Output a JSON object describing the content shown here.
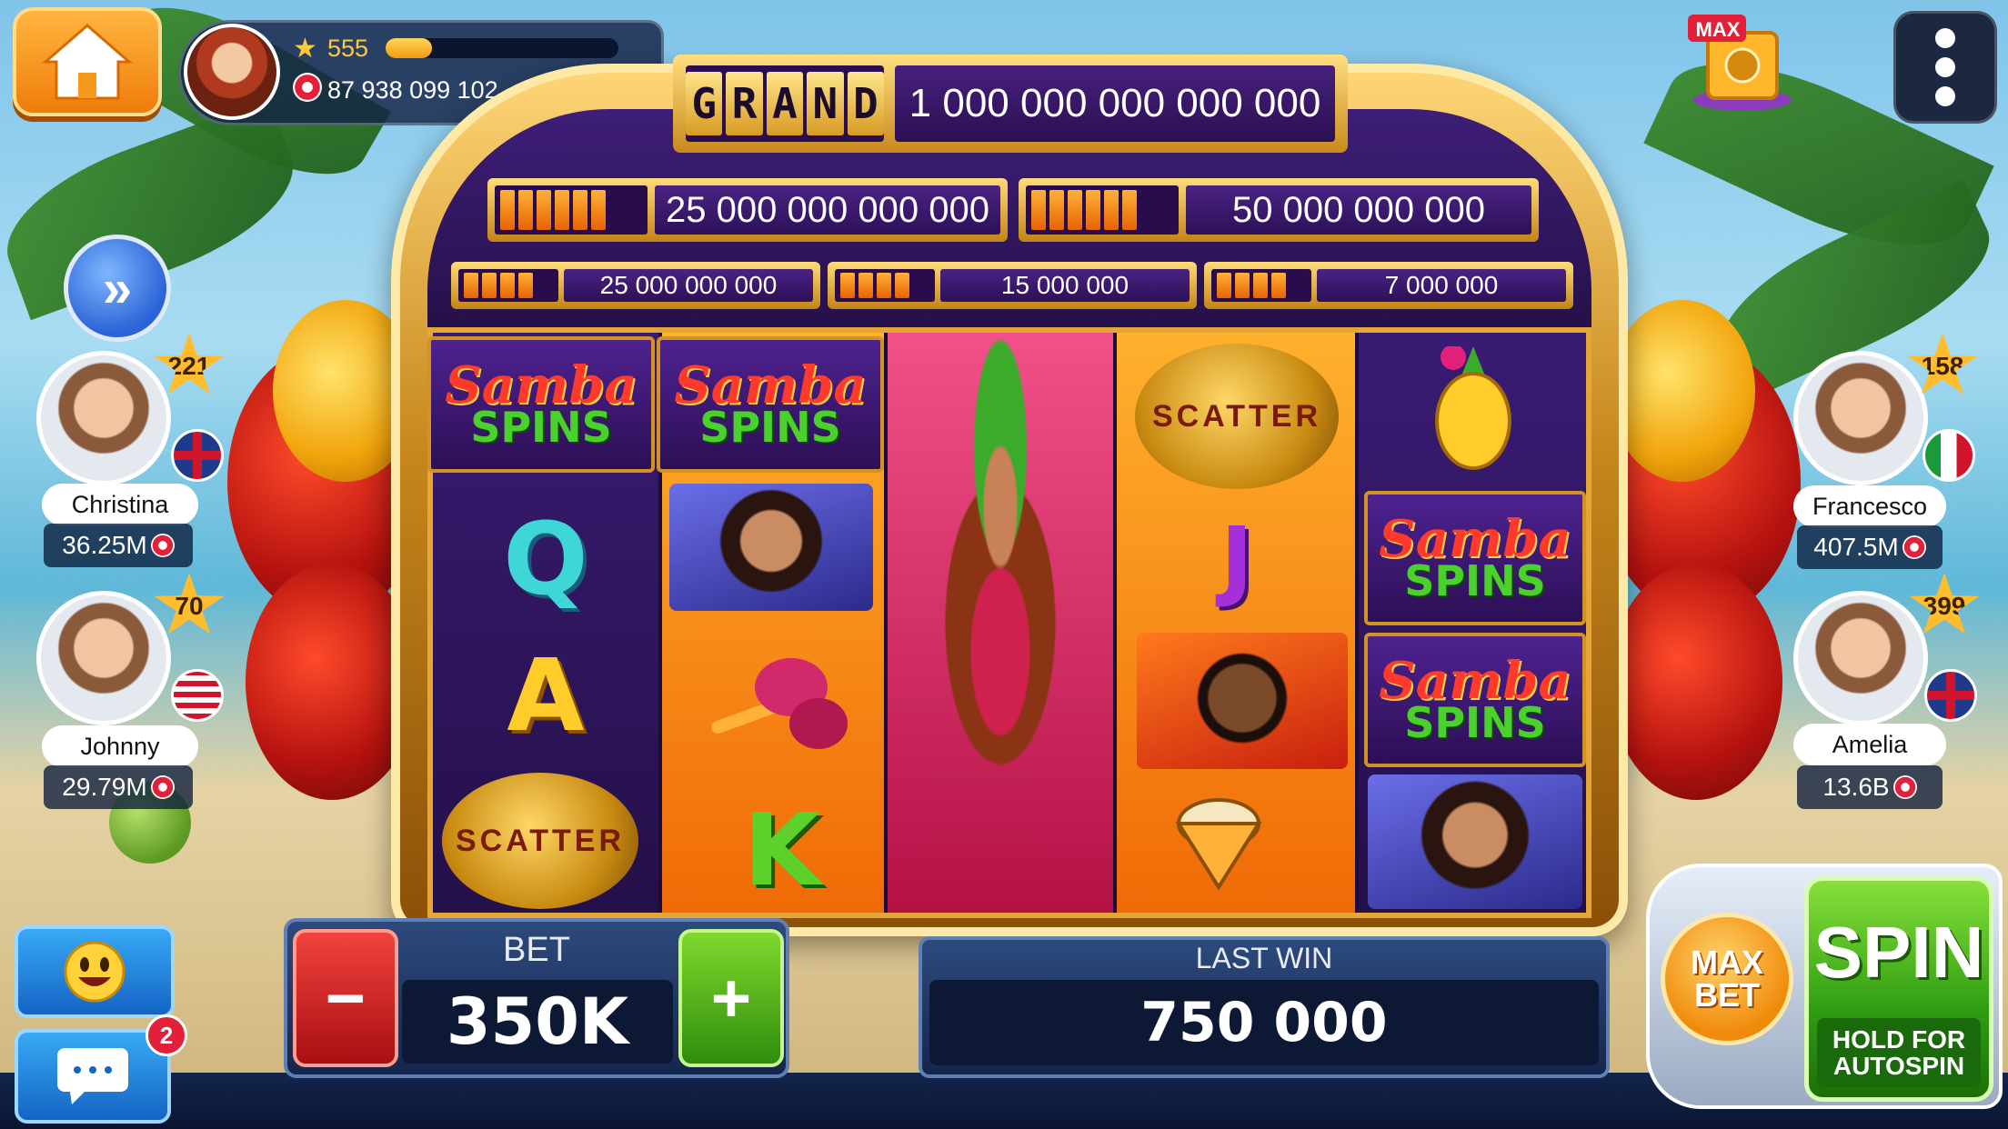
{
  "player": {
    "level": "555",
    "xp_progress": 0.2,
    "chips": "87 938 099 102"
  },
  "top_right": {
    "vault_label": "MAX"
  },
  "jackpots": {
    "grand_label": [
      "G",
      "R",
      "A",
      "N",
      "D"
    ],
    "grand_value": "1 000 000 000 000 000",
    "major_left": "25 000 000 000 000",
    "major_right": "50 000 000 000",
    "minor_1": "25 000 000 000",
    "minor_2": "15 000 000",
    "minor_3": "7 000 000"
  },
  "reels": {
    "samba_line1": "Samba",
    "samba_line2": "SPINS",
    "scatter_text": "SCATTER",
    "letter_q": "Q",
    "letter_a": "A",
    "letter_k": "K",
    "letter_j": "J"
  },
  "players": {
    "left": [
      {
        "name": "Christina",
        "money": "36.25M",
        "level": "221",
        "flag": "uk"
      },
      {
        "name": "Johnny",
        "money": "29.79M",
        "level": "70",
        "flag": "us"
      }
    ],
    "right": [
      {
        "name": "Francesco",
        "money": "407.5M",
        "level": "158",
        "flag": "it"
      },
      {
        "name": "Amelia",
        "money": "13.6B",
        "level": "399",
        "flag": "uk"
      }
    ]
  },
  "controls": {
    "skip_icon": "»",
    "chat_badge": "2",
    "minus": "−",
    "plus": "+",
    "bet_label": "BET",
    "bet_value": "350K",
    "last_win_label": "LAST WIN",
    "last_win_value": "750 000",
    "max_bet_line1": "MAX",
    "max_bet_line2": "BET",
    "spin_label": "SPIN",
    "autospin_line1": "HOLD FOR",
    "autospin_line2": "AUTOSPIN"
  },
  "icons": [
    "home-icon",
    "star-icon",
    "chip-icon",
    "menu-dots-icon",
    "vault-icon",
    "skip-forward-icon",
    "emoji-icon",
    "chat-icon"
  ],
  "colors": {
    "accent_gold": "#e6a637",
    "spin_green": "#2f9d12",
    "minus_red": "#a90f12",
    "panel_navy": "#15264d"
  }
}
